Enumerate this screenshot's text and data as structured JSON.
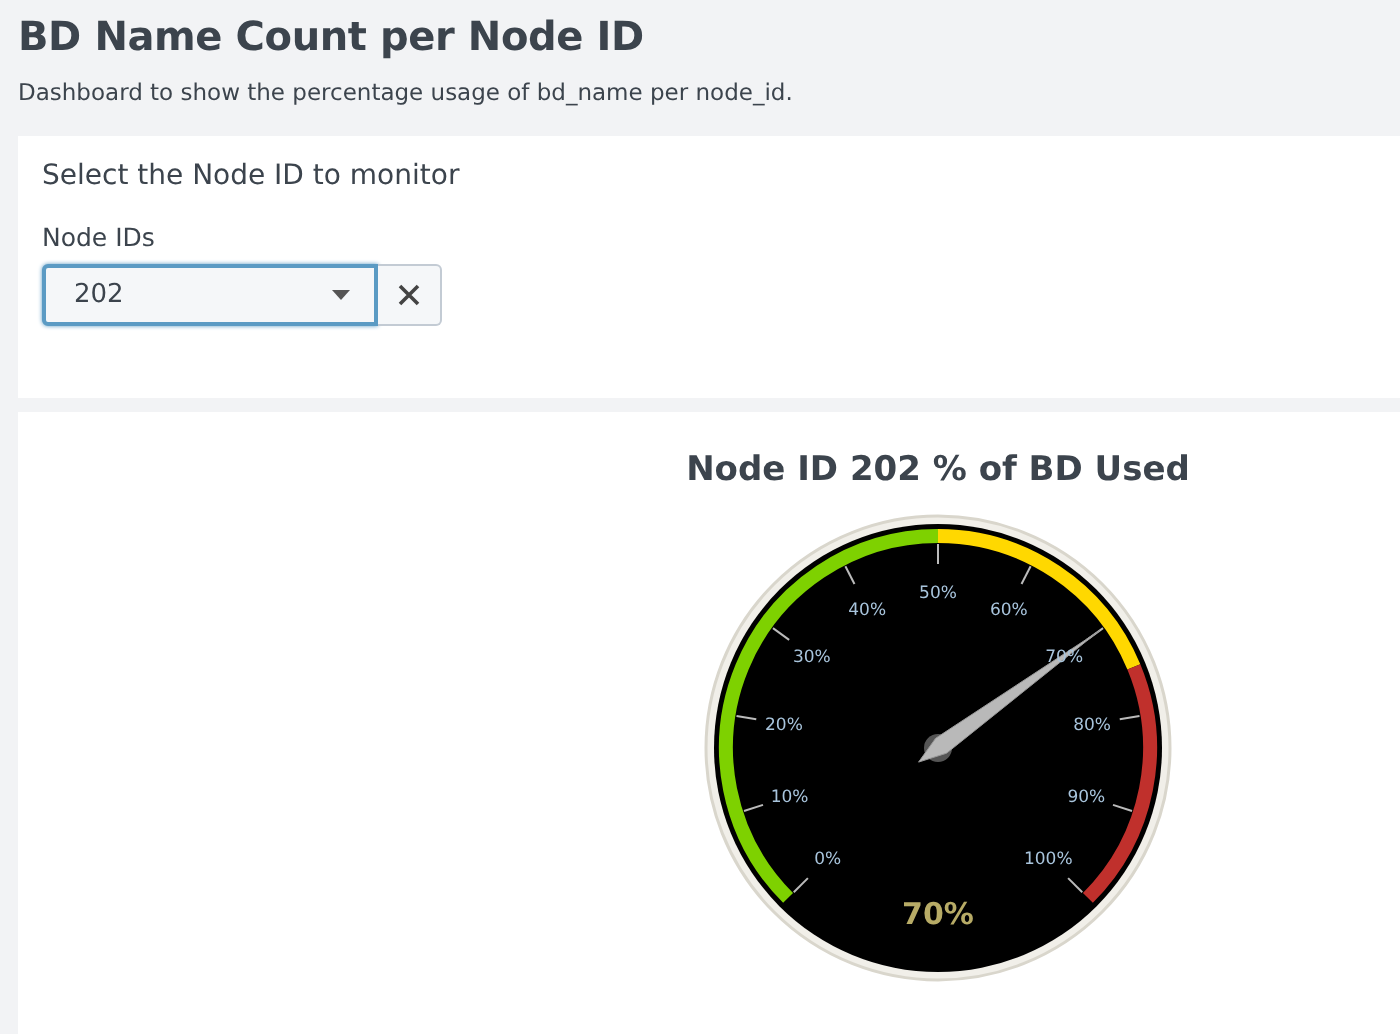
{
  "header": {
    "title": "BD Name Count per Node ID",
    "description": "Dashboard to show the percentage usage of bd_name per node_id."
  },
  "input_panel": {
    "heading": "Select the Node ID to monitor",
    "label": "Node IDs",
    "dropdown": {
      "value": "202",
      "focused": true
    }
  },
  "gauge_panel": {
    "title": "Node ID 202 % of BD Used",
    "gauge": {
      "level": 0.7,
      "value": "70%",
      "ticks": [
        "0%",
        "10%",
        "20%",
        "30%",
        "40%",
        "50%",
        "60%",
        "70%",
        "80%",
        "90%",
        "100%"
      ],
      "bands": [
        {
          "color": "#7ed100"
        },
        {
          "color": "#ffd800"
        },
        {
          "color": "#c0302c"
        }
      ]
    }
  }
}
